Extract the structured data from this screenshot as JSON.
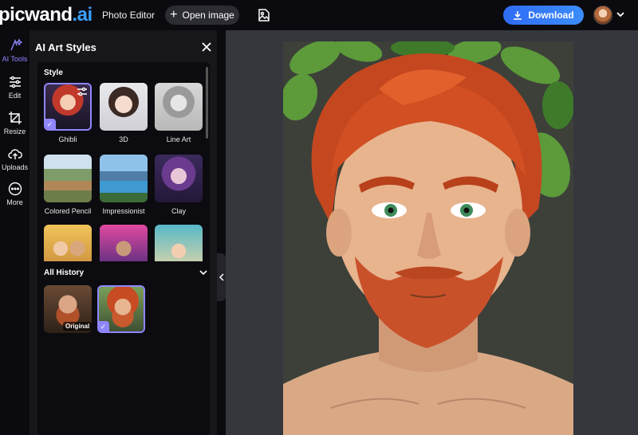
{
  "app": {
    "logo_main": "picwand",
    "logo_suffix": ".ai"
  },
  "topbar": {
    "photo_editor": "Photo Editor",
    "open_image": "Open image",
    "download": "Download"
  },
  "rail": {
    "items": [
      {
        "label": "AI Tools",
        "icon": "ai-sparkle-icon"
      },
      {
        "label": "Edit",
        "icon": "sliders-icon"
      },
      {
        "label": "Resize",
        "icon": "crop-icon"
      },
      {
        "label": "Uploads",
        "icon": "cloud-upload-icon"
      },
      {
        "label": "More",
        "icon": "more-dots-icon"
      }
    ]
  },
  "panel": {
    "title": "AI Art Styles",
    "style_section": "Style",
    "styles": [
      {
        "label": "Ghibli",
        "selected": true
      },
      {
        "label": "3D",
        "selected": false
      },
      {
        "label": "Line Art",
        "selected": false
      },
      {
        "label": "Colored Pencil",
        "selected": false
      },
      {
        "label": "Impressionist",
        "selected": false
      },
      {
        "label": "Clay",
        "selected": false
      }
    ],
    "history_section": "All History",
    "history": [
      {
        "tag": "Original"
      }
    ]
  },
  "colors": {
    "accent": "#8f86ff",
    "download_blue": "#2f6bf6",
    "canvas_bg": "#35373d"
  }
}
